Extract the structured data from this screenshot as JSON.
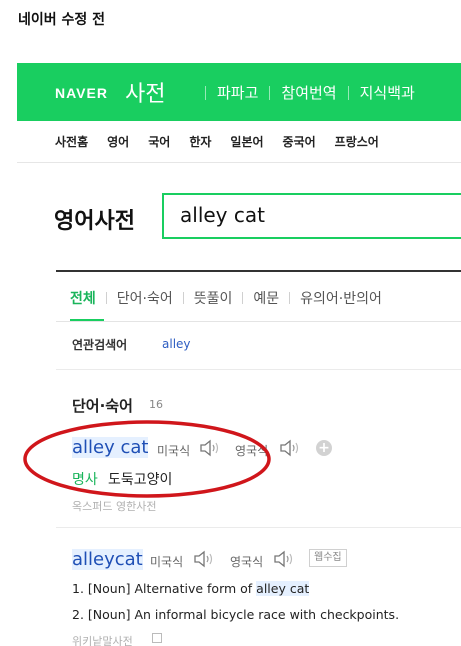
{
  "caption": "네이버 수정 전",
  "header": {
    "logo": "NAVER",
    "title": "사전",
    "nav": [
      "파파고",
      "참여번역",
      "지식백과"
    ]
  },
  "subnav": [
    "사전홈",
    "영어",
    "국어",
    "한자",
    "일본어",
    "중국어",
    "프랑스어"
  ],
  "search": {
    "dict_name": "영어사전",
    "value": "alley cat"
  },
  "tabs": [
    "전체",
    "단어·숙어",
    "뜻풀이",
    "예문",
    "유의어·반의어"
  ],
  "related": {
    "label": "연관검색어",
    "word": "alley"
  },
  "section": {
    "title": "단어·숙어",
    "count": "16"
  },
  "entry1": {
    "word": "alley cat",
    "pron_us": "미국식",
    "pron_uk": "영국식",
    "pos": "명사",
    "meaning": "도둑고양이",
    "source": "옥스퍼드 영한사전"
  },
  "entry2": {
    "word": "alleycat",
    "pron_us": "미국식",
    "pron_uk": "영국식",
    "badge": "웹수집",
    "def1_prefix": "1. [Noun] Alternative form of ",
    "def1_link": "alley cat",
    "def2": "2. [Noun] An informal bicycle race with checkpoints.",
    "source": "위키낱말사전"
  },
  "colors": {
    "naver_green": "#19ce60",
    "link_blue": "#1f4fb5",
    "annotation_red": "#d0161b"
  },
  "icons": [
    "speaker-icon",
    "plus-circle-icon",
    "copy-icon"
  ]
}
